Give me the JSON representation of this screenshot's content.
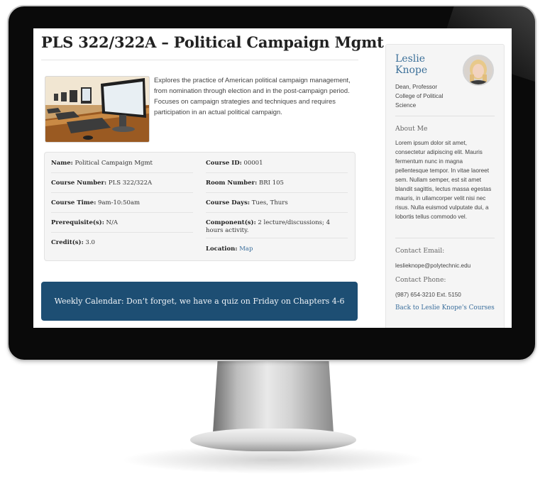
{
  "page": {
    "title": "PLS 322/322A – Political Campaign Mgmt",
    "description": "Explores the practice of American political campaign management, from nomination through election and in the post-campaign period. Focuses on campaign strategies and techniques and requires participation in an actual political campaign.",
    "image_icon": "computer-lab-photo"
  },
  "course_info": {
    "name_label": "Name:",
    "name_value": "Political Campaign Mgmt",
    "course_id_label": "Course ID:",
    "course_id_value": "00001",
    "number_label": "Course Number:",
    "number_value": "PLS 322/322A",
    "room_label": "Room Number:",
    "room_value": "BRI 105",
    "time_label": "Course Time:",
    "time_value": "9am-10:50am",
    "days_label": "Course Days:",
    "days_value": "Tues, Thurs",
    "prereq_label": "Prerequisite(s):",
    "prereq_value": "N/A",
    "components_label": "Component(s):",
    "components_value": "2 lecture/discussions; 4 hours activity.",
    "credits_label": "Credit(s):",
    "credits_value": "3.0",
    "location_label": "Location:",
    "location_link": "Map"
  },
  "calendar": {
    "text": "Weekly Calendar: Don’t forget, we have a quiz on Friday on Chapters 4-6"
  },
  "sidebar": {
    "name": "Leslie Knope",
    "title_line1": "Dean, Professor",
    "title_line2": "College of Political",
    "title_line3": "Science",
    "about_heading": "About Me",
    "about_text": "Lorem ipsum dolor sit amet, consectetur adipiscing elit. Mauris fermentum nunc in magna pellentesque tempor. In vitae laoreet sem. Nullam semper, est sit amet blandit sagittis, lectus massa egestas mauris, in ullamcorper velit nisi nec risus. Nulla euismod vulputate dui, a lobortis tellus commodo vel.",
    "email_heading": "Contact Email:",
    "email_value": "leslieknope@polytechnic.edu",
    "phone_heading": "Contact Phone:",
    "phone_value": "(987) 654-3210 Ext. 5150",
    "back_link": "Back to Leslie Knope's Courses"
  },
  "colors": {
    "banner": "#1d4e73",
    "link": "#3a6e9c",
    "panel": "#f5f5f5"
  }
}
